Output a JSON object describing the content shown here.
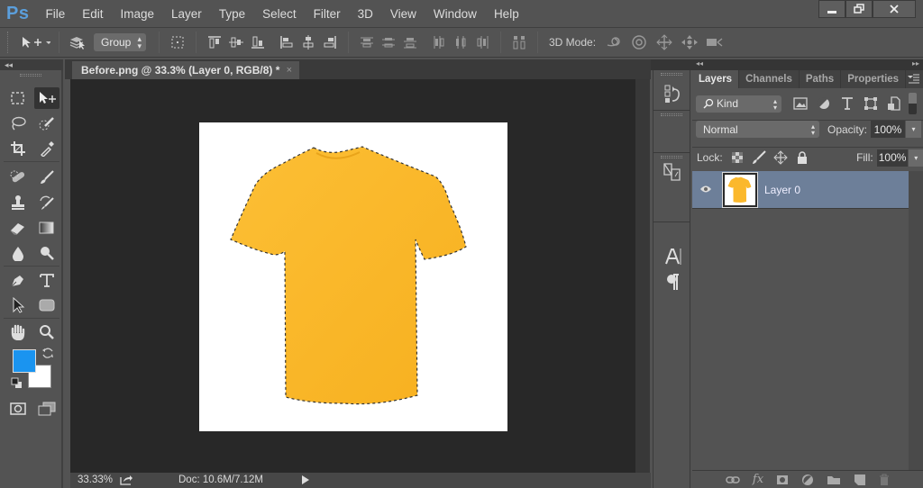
{
  "app": {
    "logo": "Ps"
  },
  "menu": [
    "File",
    "Edit",
    "Image",
    "Layer",
    "Type",
    "Select",
    "Filter",
    "3D",
    "View",
    "Window",
    "Help"
  ],
  "window_controls": {
    "minimize": "minimize-icon",
    "restore": "restore-icon",
    "close": "close-icon"
  },
  "options_bar": {
    "auto_select_value": "Group",
    "align_icons": [
      "align-top-edges",
      "align-vertical-centers",
      "align-bottom-edges",
      "align-left-edges",
      "align-horizontal-centers",
      "align-right-edges"
    ],
    "distribute_icons": [
      "distribute-top",
      "distribute-vertical-centers",
      "distribute-bottom",
      "distribute-left",
      "distribute-horizontal-centers",
      "distribute-right"
    ],
    "auto_align_icon": "auto-align-layers",
    "mode_label": "3D Mode:",
    "mode_icons": [
      "rotate-3d",
      "roll-3d",
      "drag-3d",
      "slide-3d",
      "scale-camera-3d"
    ]
  },
  "document": {
    "tab_title": "Before.png @ 33.3% (Layer 0, RGB/8) *",
    "close": "×",
    "zoom": "33.33%",
    "doc_info": "Doc: 10.6M/7.12M"
  },
  "toolbar": {
    "tools": [
      "rectangular-marquee",
      "move",
      "lasso",
      "quick-selection",
      "crop",
      "eyedropper",
      "spot-healing-brush",
      "brush",
      "clone-stamp",
      "history-brush",
      "eraser",
      "gradient",
      "blur",
      "dodge",
      "pen",
      "type",
      "path-selection",
      "rectangle",
      "hand",
      "zoom"
    ],
    "foreground_color": "#1a94f0",
    "background_color": "#ffffff"
  },
  "panels": {
    "tabs": [
      "Layers",
      "Channels",
      "Paths",
      "Properties"
    ],
    "active_tab": "Layers",
    "filter_kind": "Kind",
    "blend_mode": "Normal",
    "opacity_label": "Opacity:",
    "opacity_value": "100%",
    "lock_label": "Lock:",
    "fill_label": "Fill:",
    "fill_value": "100%",
    "layers": [
      {
        "name": "Layer 0",
        "visible": true,
        "selected": true
      }
    ],
    "footer_icons": [
      "link-layers",
      "fx",
      "add-mask",
      "adjustment-layer",
      "new-group",
      "new-layer",
      "delete-layer"
    ]
  },
  "colors": {
    "shirt": "#fbb82c",
    "selected_layer": "#6d7f99",
    "accent": "#5b9fdc"
  }
}
